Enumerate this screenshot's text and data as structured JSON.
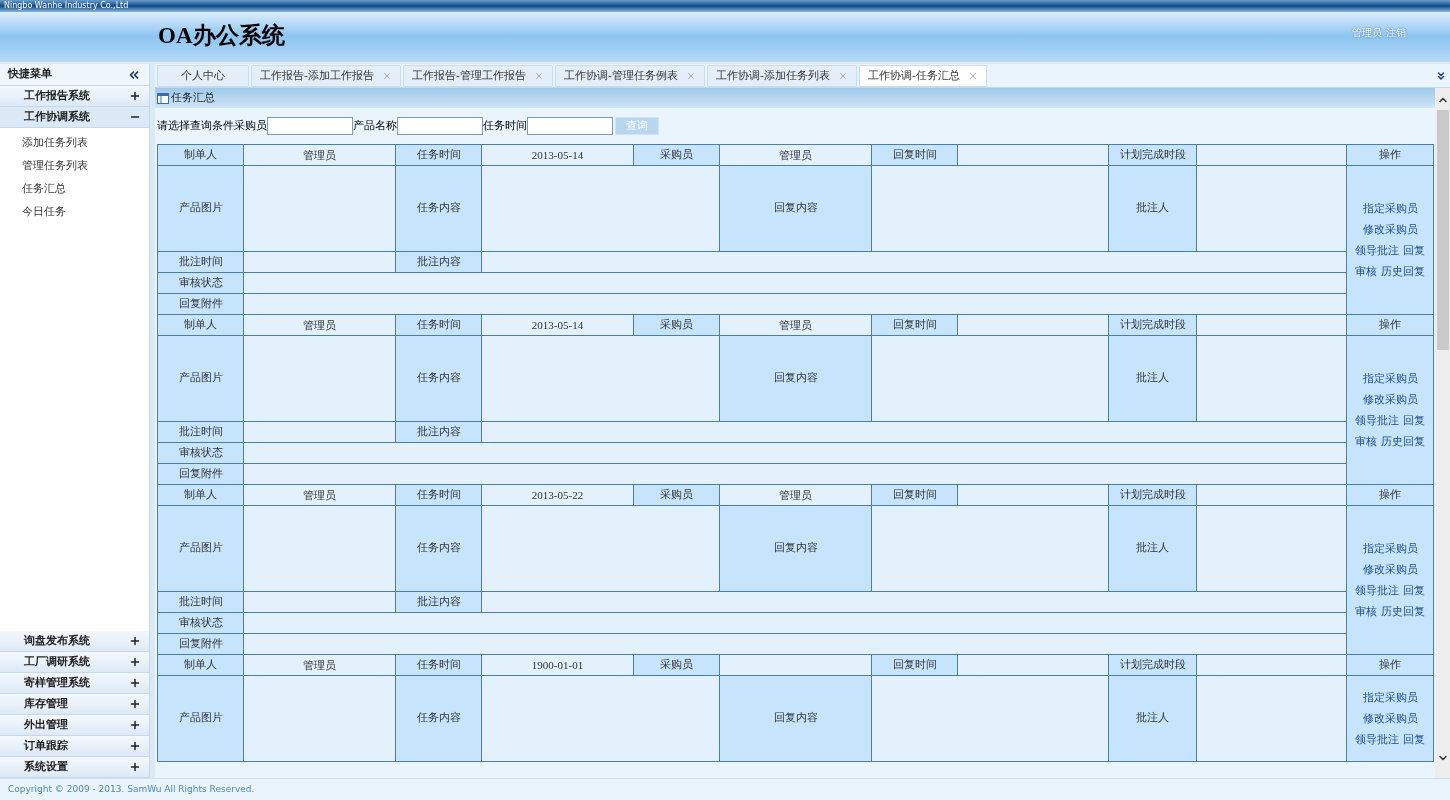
{
  "company": "Ningbo Wanhe Industry Co.,Ltd",
  "app_title": "OA办公系统",
  "user": {
    "name": "管理员",
    "logout": "注销"
  },
  "sidebar": {
    "title": "快捷菜单",
    "groups": [
      {
        "label": "工作报告系统",
        "expanded": false
      },
      {
        "label": "工作协调系统",
        "expanded": true,
        "items": [
          {
            "label": "添加任务列表"
          },
          {
            "label": "管理任务列表"
          },
          {
            "label": "任务汇总"
          },
          {
            "label": "今日任务"
          }
        ]
      },
      {
        "label": "询盘发布系统",
        "expanded": false
      },
      {
        "label": "工厂调研系统",
        "expanded": false
      },
      {
        "label": "寄样管理系统",
        "expanded": false
      },
      {
        "label": "库存管理",
        "expanded": false
      },
      {
        "label": "外出管理",
        "expanded": false
      },
      {
        "label": "订单跟踪",
        "expanded": false
      },
      {
        "label": "系统设置",
        "expanded": false
      }
    ]
  },
  "tabs": [
    {
      "label": "个人中心",
      "closable": false,
      "selected": false
    },
    {
      "label": "工作报告-添加工作报告",
      "closable": true,
      "selected": false
    },
    {
      "label": "工作报告-管理工作报告",
      "closable": true,
      "selected": false
    },
    {
      "label": "工作协调-管理任务例表",
      "closable": true,
      "selected": false
    },
    {
      "label": "工作协调-添加任务列表",
      "closable": true,
      "selected": false
    },
    {
      "label": "工作协调-任务汇总",
      "closable": true,
      "selected": true
    }
  ],
  "panel_title": "任务汇总",
  "search": {
    "fields": [
      {
        "label": "请选择查询条件采购员"
      },
      {
        "label": "产品名称"
      },
      {
        "label": "任务时间"
      }
    ],
    "button": "查询"
  },
  "records": [
    {
      "rows": [
        {
          "cells": [
            {
              "kind": "label",
              "text": "制单人"
            },
            {
              "kind": "value",
              "text": "管理员"
            },
            {
              "kind": "label",
              "text": "任务时间"
            },
            {
              "kind": "value",
              "text": "2013-05-14"
            },
            {
              "kind": "label",
              "text": "采购员"
            },
            {
              "kind": "value",
              "text": "管理员"
            },
            {
              "kind": "label",
              "text": "回复时间"
            },
            {
              "kind": "value"
            },
            {
              "kind": "label",
              "text": "计划完成时段"
            },
            {
              "kind": "value"
            },
            {
              "kind": "label",
              "text": "操作"
            }
          ]
        },
        {
          "cells": [
            {
              "kind": "label",
              "text": "产品图片"
            },
            {
              "kind": "value"
            },
            {
              "kind": "label",
              "text": "任务内容"
            },
            {
              "kind": "value"
            },
            {
              "kind": "merged"
            },
            {
              "kind": "label",
              "text": "回复内容"
            },
            {
              "kind": "value"
            },
            {
              "kind": "merged"
            },
            {
              "kind": "label",
              "text": "批注人"
            },
            {
              "kind": "value"
            },
            {
              "kind": "actions"
            }
          ]
        },
        {
          "cells": [
            {
              "kind": "label",
              "text": "批注时间"
            },
            {
              "kind": "value"
            },
            {
              "kind": "label",
              "text": "批注内容"
            },
            {
              "kind": "value"
            },
            {
              "kind": "merged"
            },
            {
              "kind": "merged"
            },
            {
              "kind": "merged"
            },
            {
              "kind": "merged"
            },
            {
              "kind": "merged"
            },
            {
              "kind": "merged"
            }
          ]
        },
        {
          "cells": [
            {
              "kind": "label",
              "text": "审核状态"
            },
            {
              "kind": "value"
            },
            {
              "kind": "merged"
            },
            {
              "kind": "merged"
            },
            {
              "kind": "merged"
            },
            {
              "kind": "merged"
            },
            {
              "kind": "merged"
            },
            {
              "kind": "merged"
            },
            {
              "kind": "merged"
            },
            {
              "kind": "merged"
            }
          ]
        },
        {
          "cells": [
            {
              "kind": "label",
              "text": "回复附件"
            },
            {
              "kind": "value"
            },
            {
              "kind": "merged"
            },
            {
              "kind": "merged"
            },
            {
              "kind": "merged"
            },
            {
              "kind": "merged"
            },
            {
              "kind": "merged"
            },
            {
              "kind": "merged"
            },
            {
              "kind": "merged"
            },
            {
              "kind": "merged"
            }
          ]
        }
      ],
      "actions": [
        "指定采购员",
        "修改采购员",
        "领导批注",
        "回复",
        "审核",
        "历史回复"
      ]
    },
    {
      "rows": [
        {
          "cells": [
            {
              "kind": "label",
              "text": "制单人"
            },
            {
              "kind": "value",
              "text": "管理员"
            },
            {
              "kind": "label",
              "text": "任务时间"
            },
            {
              "kind": "value",
              "text": "2013-05-14"
            },
            {
              "kind": "label",
              "text": "采购员"
            },
            {
              "kind": "value",
              "text": "管理员"
            },
            {
              "kind": "label",
              "text": "回复时间"
            },
            {
              "kind": "value"
            },
            {
              "kind": "label",
              "text": "计划完成时段"
            },
            {
              "kind": "value"
            },
            {
              "kind": "label",
              "text": "操作"
            }
          ]
        },
        {
          "cells": [
            {
              "kind": "label",
              "text": "产品图片"
            },
            {
              "kind": "value"
            },
            {
              "kind": "label",
              "text": "任务内容"
            },
            {
              "kind": "value"
            },
            {
              "kind": "merged"
            },
            {
              "kind": "label",
              "text": "回复内容"
            },
            {
              "kind": "value"
            },
            {
              "kind": "merged"
            },
            {
              "kind": "label",
              "text": "批注人"
            },
            {
              "kind": "value"
            },
            {
              "kind": "actions"
            }
          ]
        },
        {
          "cells": [
            {
              "kind": "label",
              "text": "批注时间"
            },
            {
              "kind": "value"
            },
            {
              "kind": "label",
              "text": "批注内容"
            },
            {
              "kind": "value"
            },
            {
              "kind": "merged"
            },
            {
              "kind": "merged"
            },
            {
              "kind": "merged"
            },
            {
              "kind": "merged"
            },
            {
              "kind": "merged"
            },
            {
              "kind": "merged"
            }
          ]
        },
        {
          "cells": [
            {
              "kind": "label",
              "text": "审核状态"
            },
            {
              "kind": "value"
            },
            {
              "kind": "merged"
            },
            {
              "kind": "merged"
            },
            {
              "kind": "merged"
            },
            {
              "kind": "merged"
            },
            {
              "kind": "merged"
            },
            {
              "kind": "merged"
            },
            {
              "kind": "merged"
            },
            {
              "kind": "merged"
            }
          ]
        },
        {
          "cells": [
            {
              "kind": "label",
              "text": "回复附件"
            },
            {
              "kind": "value"
            },
            {
              "kind": "merged"
            },
            {
              "kind": "merged"
            },
            {
              "kind": "merged"
            },
            {
              "kind": "merged"
            },
            {
              "kind": "merged"
            },
            {
              "kind": "merged"
            },
            {
              "kind": "merged"
            },
            {
              "kind": "merged"
            }
          ]
        }
      ],
      "actions": [
        "指定采购员",
        "修改采购员",
        "领导批注",
        "回复",
        "审核",
        "历史回复"
      ]
    },
    {
      "rows": [
        {
          "cells": [
            {
              "kind": "label",
              "text": "制单人"
            },
            {
              "kind": "value",
              "text": "管理员"
            },
            {
              "kind": "label",
              "text": "任务时间"
            },
            {
              "kind": "value",
              "text": "2013-05-22"
            },
            {
              "kind": "label",
              "text": "采购员"
            },
            {
              "kind": "value",
              "text": "管理员"
            },
            {
              "kind": "label",
              "text": "回复时间"
            },
            {
              "kind": "value"
            },
            {
              "kind": "label",
              "text": "计划完成时段"
            },
            {
              "kind": "value"
            },
            {
              "kind": "label",
              "text": "操作"
            }
          ]
        },
        {
          "cells": [
            {
              "kind": "label",
              "text": "产品图片"
            },
            {
              "kind": "value"
            },
            {
              "kind": "label",
              "text": "任务内容"
            },
            {
              "kind": "value"
            },
            {
              "kind": "merged"
            },
            {
              "kind": "label",
              "text": "回复内容"
            },
            {
              "kind": "value"
            },
            {
              "kind": "merged"
            },
            {
              "kind": "label",
              "text": "批注人"
            },
            {
              "kind": "value"
            },
            {
              "kind": "actions"
            }
          ]
        },
        {
          "cells": [
            {
              "kind": "label",
              "text": "批注时间"
            },
            {
              "kind": "value"
            },
            {
              "kind": "label",
              "text": "批注内容"
            },
            {
              "kind": "value"
            },
            {
              "kind": "merged"
            },
            {
              "kind": "merged"
            },
            {
              "kind": "merged"
            },
            {
              "kind": "merged"
            },
            {
              "kind": "merged"
            },
            {
              "kind": "merged"
            }
          ]
        },
        {
          "cells": [
            {
              "kind": "label",
              "text": "审核状态"
            },
            {
              "kind": "value"
            },
            {
              "kind": "merged"
            },
            {
              "kind": "merged"
            },
            {
              "kind": "merged"
            },
            {
              "kind": "merged"
            },
            {
              "kind": "merged"
            },
            {
              "kind": "merged"
            },
            {
              "kind": "merged"
            },
            {
              "kind": "merged"
            }
          ]
        },
        {
          "cells": [
            {
              "kind": "label",
              "text": "回复附件"
            },
            {
              "kind": "value"
            },
            {
              "kind": "merged"
            },
            {
              "kind": "merged"
            },
            {
              "kind": "merged"
            },
            {
              "kind": "merged"
            },
            {
              "kind": "merged"
            },
            {
              "kind": "merged"
            },
            {
              "kind": "merged"
            },
            {
              "kind": "merged"
            }
          ]
        }
      ],
      "actions": [
        "指定采购员",
        "修改采购员",
        "领导批注",
        "回复",
        "审核",
        "历史回复"
      ]
    },
    {
      "rows": [
        {
          "cells": [
            {
              "kind": "label",
              "text": "制单人"
            },
            {
              "kind": "value",
              "text": "管理员"
            },
            {
              "kind": "label",
              "text": "任务时间"
            },
            {
              "kind": "value",
              "text": "1900-01-01"
            },
            {
              "kind": "label",
              "text": "采购员"
            },
            {
              "kind": "value"
            },
            {
              "kind": "label",
              "text": "回复时间"
            },
            {
              "kind": "value"
            },
            {
              "kind": "label",
              "text": "计划完成时段"
            },
            {
              "kind": "value"
            },
            {
              "kind": "label",
              "text": "操作"
            }
          ]
        },
        {
          "cells": [
            {
              "kind": "label",
              "text": "产品图片"
            },
            {
              "kind": "value"
            },
            {
              "kind": "label",
              "text": "任务内容"
            },
            {
              "kind": "value"
            },
            {
              "kind": "merged"
            },
            {
              "kind": "label",
              "text": "回复内容"
            },
            {
              "kind": "value"
            },
            {
              "kind": "merged"
            },
            {
              "kind": "label",
              "text": "批注人"
            },
            {
              "kind": "value"
            },
            {
              "kind": "actions"
            }
          ]
        }
      ],
      "actions": [
        "指定采购员",
        "修改采购员",
        "领导批注",
        "回复"
      ]
    }
  ],
  "footer": "Copyright © 2009 - 2013. SamWu All Rights Reserved."
}
